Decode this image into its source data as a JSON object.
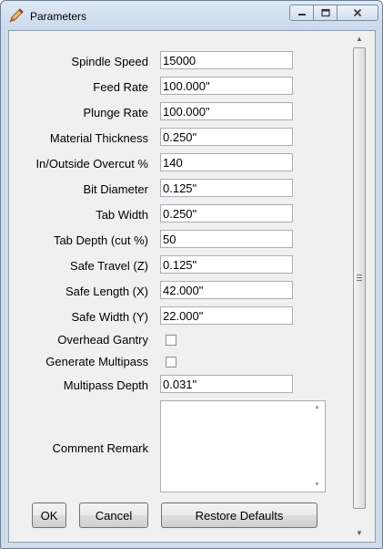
{
  "window": {
    "title": "Parameters",
    "controls": {
      "minimize": "—",
      "maximize": "□",
      "close": "✕"
    }
  },
  "fields": [
    {
      "label": "Spindle Speed",
      "value": "15000"
    },
    {
      "label": "Feed Rate",
      "value": "100.000\""
    },
    {
      "label": "Plunge Rate",
      "value": "100.000\""
    },
    {
      "label": "Material Thickness",
      "value": "0.250\""
    },
    {
      "label": "In/Outside Overcut %",
      "value": "140"
    },
    {
      "label": "Bit Diameter",
      "value": "0.125\""
    },
    {
      "label": "Tab Width",
      "value": "0.250\""
    },
    {
      "label": "Tab Depth (cut %)",
      "value": "50"
    },
    {
      "label": "Safe Travel (Z)",
      "value": "0.125\""
    },
    {
      "label": "Safe Length (X)",
      "value": "42.000\""
    },
    {
      "label": "Safe Width (Y)",
      "value": "22.000\""
    }
  ],
  "checkboxes": [
    {
      "label": "Overhead Gantry",
      "checked": false
    },
    {
      "label": "Generate Multipass",
      "checked": false
    }
  ],
  "multipass": {
    "label": "Multipass Depth",
    "value": "0.031\""
  },
  "comment": {
    "label": "Comment Remark",
    "value": ""
  },
  "buttons": {
    "ok": "OK",
    "cancel": "Cancel",
    "restore": "Restore Defaults"
  },
  "scroll_icons": {
    "up": "▲",
    "down": "▼",
    "grip": "≡"
  }
}
